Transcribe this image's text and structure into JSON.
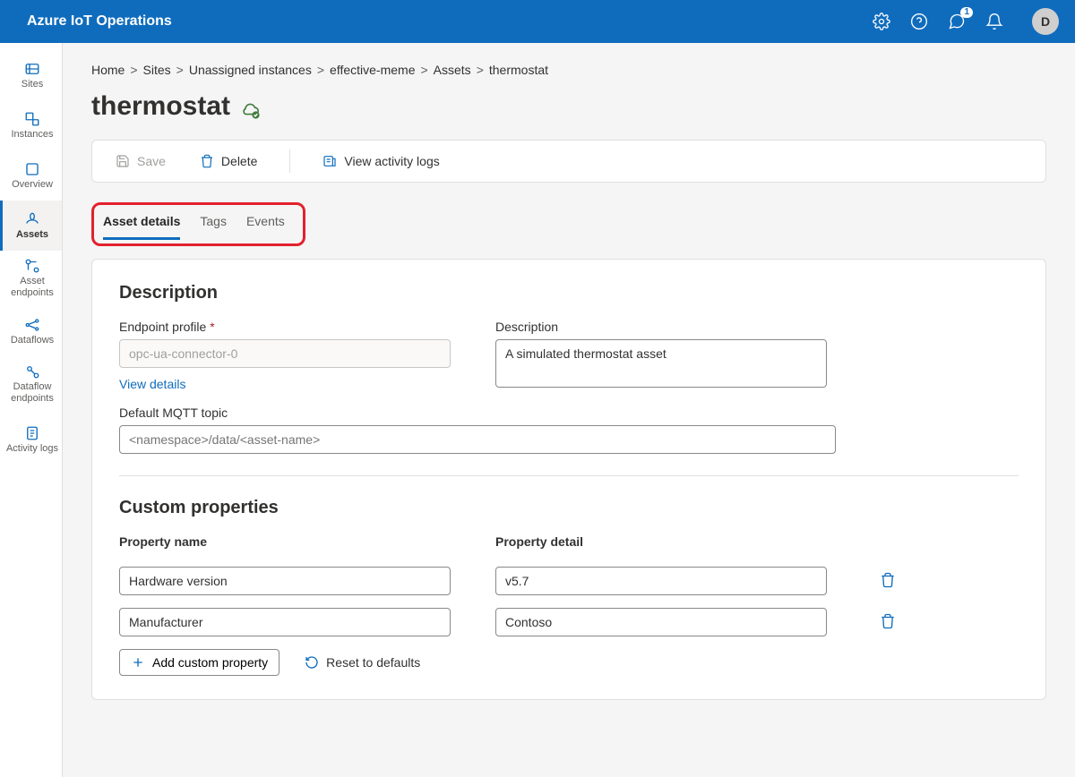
{
  "brand": "Azure IoT Operations",
  "header": {
    "feedback_badge": "1",
    "avatar_initial": "D"
  },
  "nav": {
    "items": [
      {
        "label": "Sites"
      },
      {
        "label": "Instances"
      },
      {
        "label": "Overview"
      },
      {
        "label": "Assets",
        "active": true
      },
      {
        "label": "Asset endpoints"
      },
      {
        "label": "Dataflows"
      },
      {
        "label": "Dataflow endpoints"
      },
      {
        "label": "Activity logs"
      }
    ]
  },
  "breadcrumb": {
    "items": [
      "Home",
      "Sites",
      "Unassigned instances",
      "effective-meme",
      "Assets",
      "thermostat"
    ],
    "sep": ">"
  },
  "page": {
    "title": "thermostat"
  },
  "toolbar": {
    "save_label": "Save",
    "delete_label": "Delete",
    "logs_label": "View activity logs"
  },
  "tabs": {
    "items": [
      {
        "label": "Asset details",
        "active": true
      },
      {
        "label": "Tags"
      },
      {
        "label": "Events"
      }
    ]
  },
  "description": {
    "section_title": "Description",
    "endpoint_label": "Endpoint profile",
    "endpoint_value": "opc-ua-connector-0",
    "view_details": "View details",
    "description_label": "Description",
    "description_value": "A simulated thermostat asset",
    "mqtt_label": "Default MQTT topic",
    "mqtt_placeholder": "<namespace>/data/<asset-name>"
  },
  "custom_properties": {
    "section_title": "Custom properties",
    "name_header": "Property name",
    "detail_header": "Property detail",
    "rows": [
      {
        "name": "Hardware version",
        "detail": "v5.7"
      },
      {
        "name": "Manufacturer",
        "detail": "Contoso"
      }
    ],
    "add_label": "Add custom property",
    "reset_label": "Reset to defaults"
  }
}
